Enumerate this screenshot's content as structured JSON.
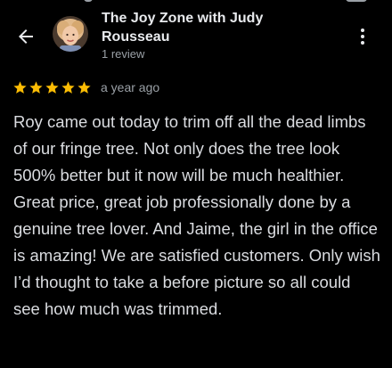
{
  "review": {
    "reviewer_name": "The Joy Zone with Judy Rousseau",
    "reviewer_review_count": "1 review",
    "rating": 5,
    "rating_max": 5,
    "time_ago": "a year ago",
    "text": "Roy came out today to trim off all the dead limbs of our fringe tree. Not only does the tree look 500% better but it now will be much healthier. Great price, great job professionally done by a genuine tree lover. And Jaime, the girl in the office is amazing! We are satisfied customers. Only wish I’d thought to take a before picture so all could see how much was trimmed."
  },
  "icons": {
    "back": "arrow-back-icon",
    "menu": "more-vert-icon",
    "star": "star-icon"
  },
  "colors": {
    "background": "#000000",
    "text_primary": "#e8eaed",
    "text_secondary": "#9aa0a6",
    "star": "#fbbc04"
  }
}
